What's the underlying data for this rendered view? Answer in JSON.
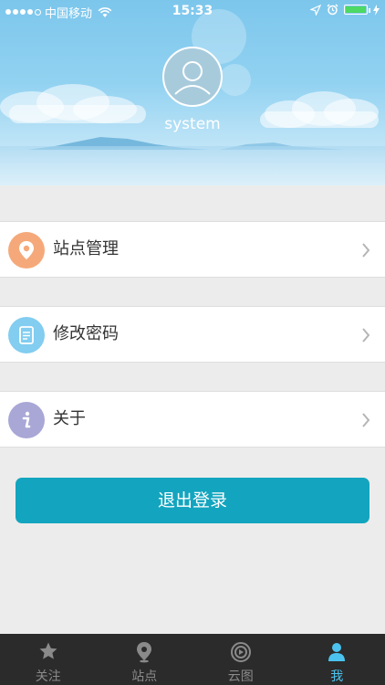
{
  "status_bar": {
    "carrier": "中国移动",
    "time": "15:33"
  },
  "profile": {
    "username": "system"
  },
  "menu": [
    {
      "label": "站点管理",
      "icon": "location-pin-icon",
      "color": "#f5a97a"
    },
    {
      "label": "修改密码",
      "icon": "document-icon",
      "color": "#82cdf0"
    },
    {
      "label": "关于",
      "icon": "info-icon",
      "color": "#a8a7d6"
    }
  ],
  "logout_label": "退出登录",
  "tabbar": {
    "tabs": [
      {
        "label": "关注",
        "icon": "star-icon",
        "active": false
      },
      {
        "label": "站点",
        "icon": "location-pin-icon",
        "active": false
      },
      {
        "label": "云图",
        "icon": "cloud-map-icon",
        "active": false
      },
      {
        "label": "我",
        "icon": "person-icon",
        "active": true
      }
    ],
    "active_color": "#4cc3ef",
    "inactive_color": "#8a8a8a"
  },
  "colors": {
    "accent": "#13a5bf",
    "header_sky": "#7cc6ec"
  }
}
